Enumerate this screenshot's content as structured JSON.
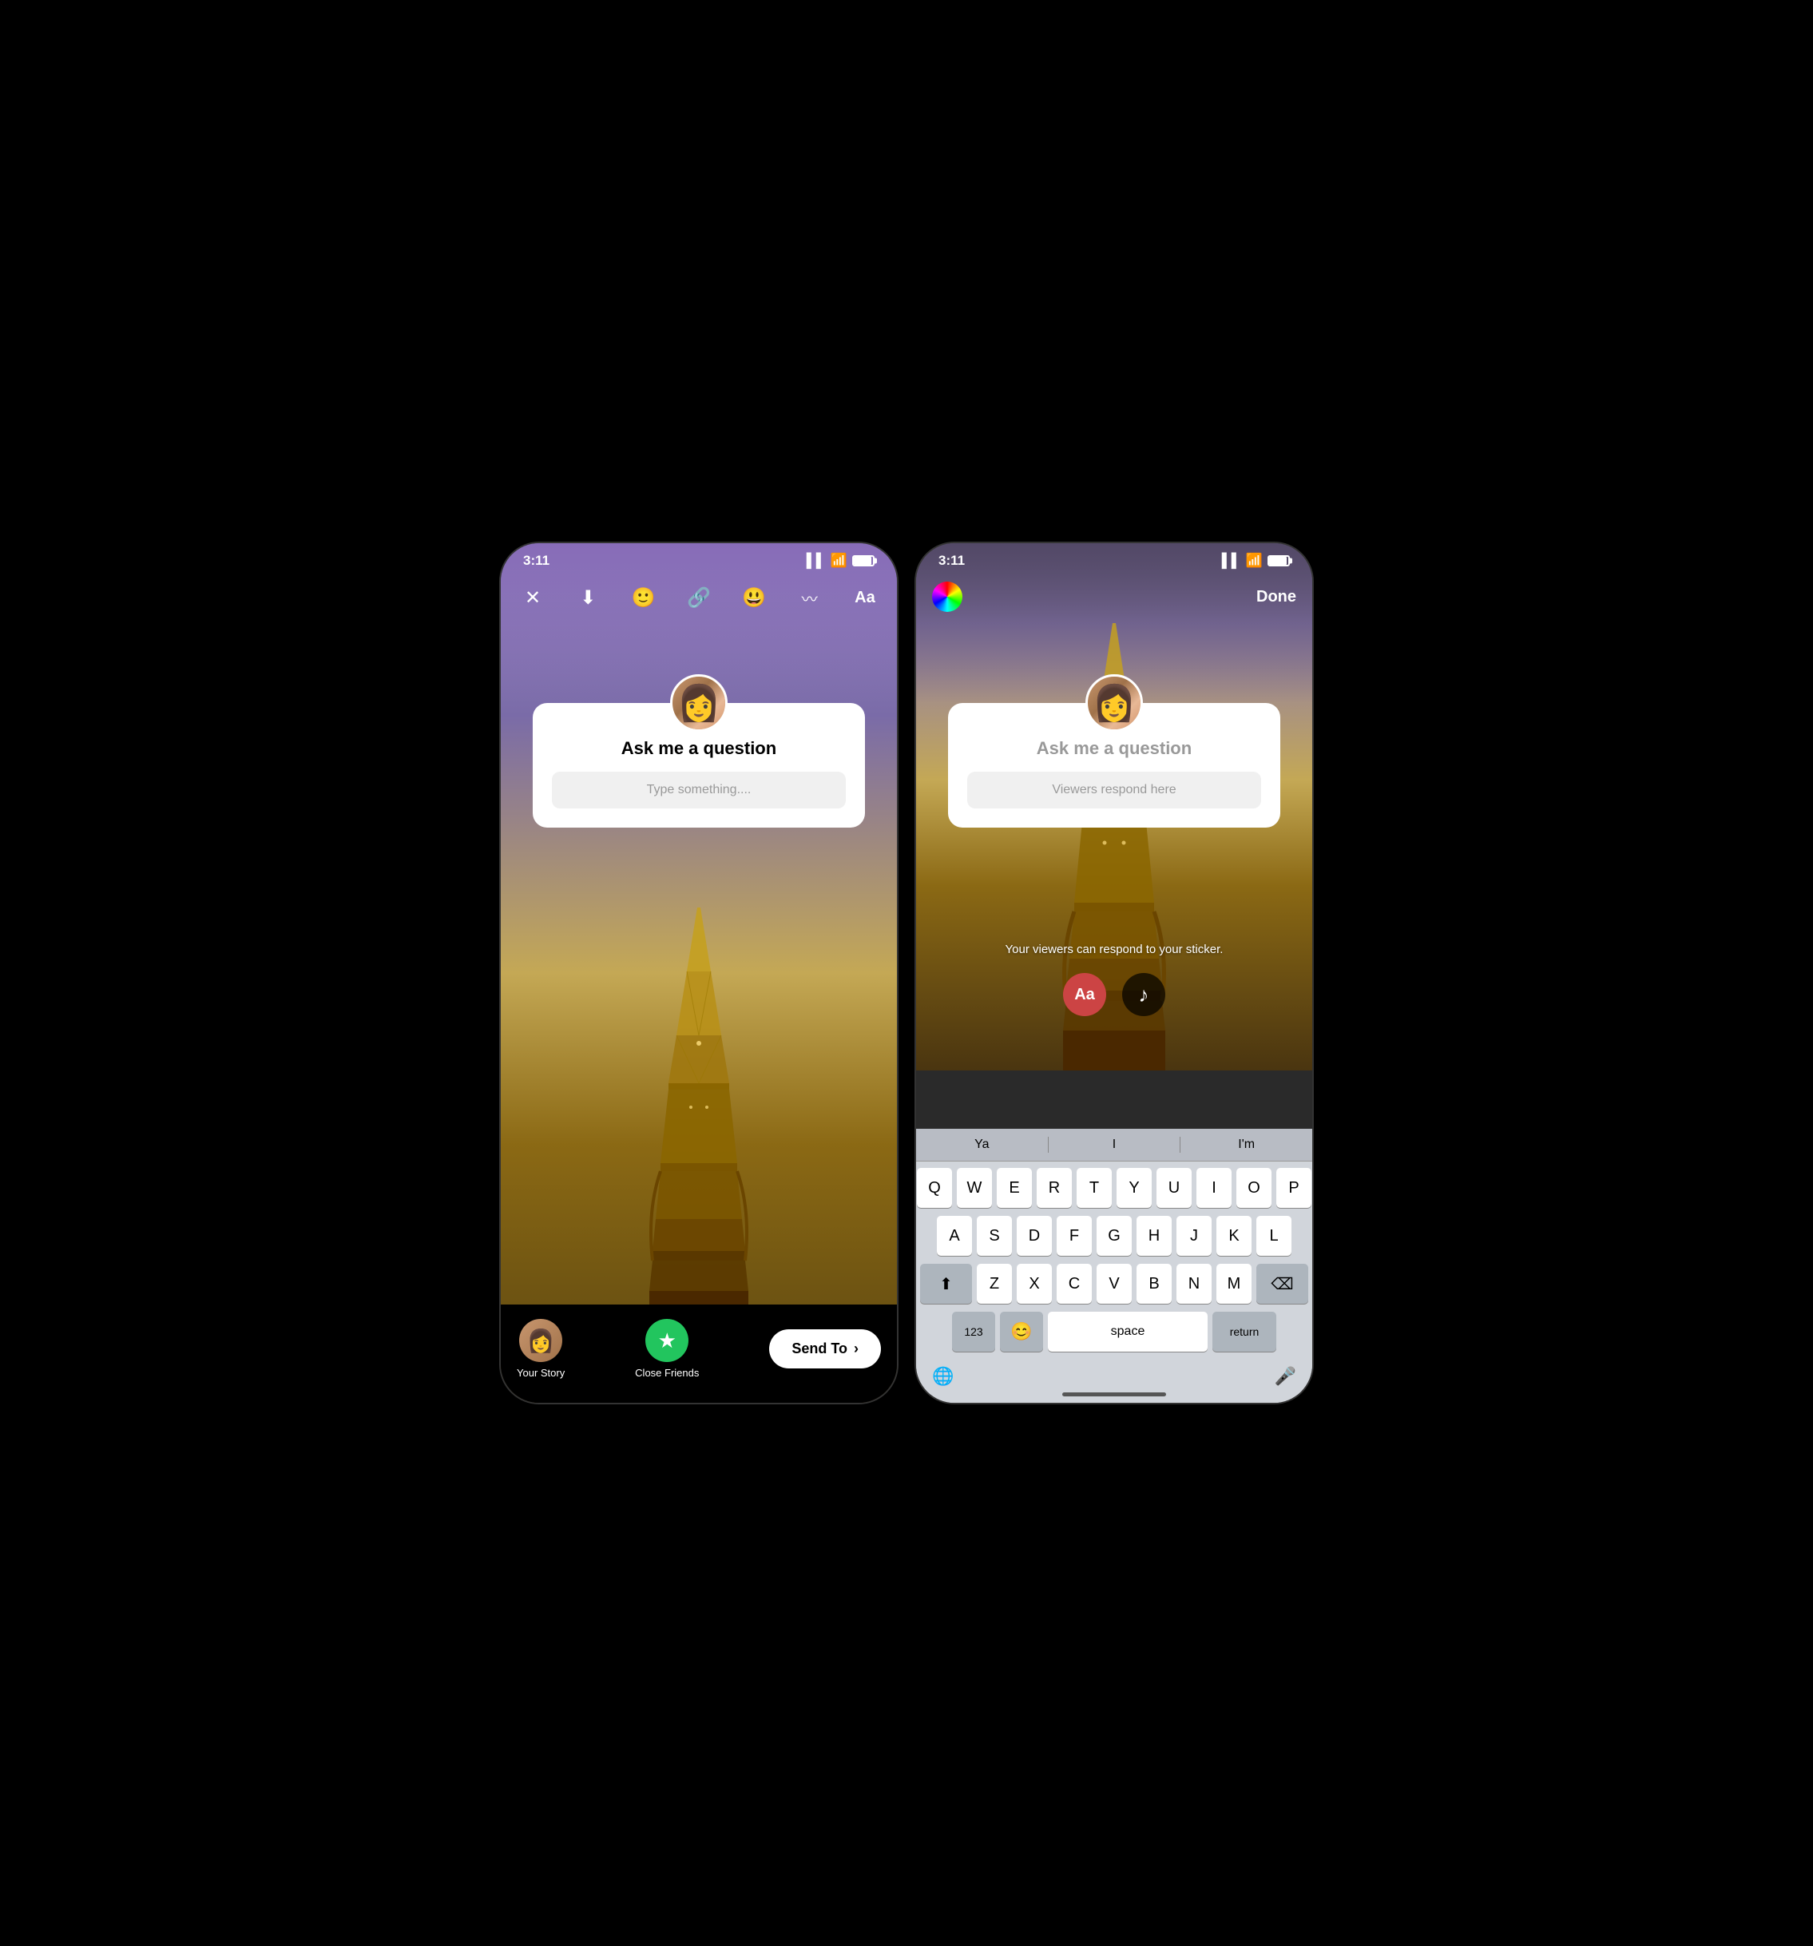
{
  "phones": {
    "left": {
      "status": {
        "time": "3:11",
        "signal": "▌▌",
        "wifi": "wifi",
        "battery": "battery"
      },
      "toolbar": {
        "close": "✕",
        "download": "↓",
        "emoji_add": "😊+",
        "link": "🔗",
        "sticker": "😃",
        "squiggle": "〰",
        "text": "Aa"
      },
      "question_card": {
        "title": "Ask me a question",
        "input_placeholder": "Type something...."
      },
      "bottom_bar": {
        "your_story_label": "Your Story",
        "close_friends_label": "Close Friends",
        "send_to_label": "Send To",
        "send_arrow": "›"
      }
    },
    "right": {
      "status": {
        "time": "3:11"
      },
      "toolbar": {
        "color_wheel": "colorwheel",
        "done": "Done"
      },
      "question_card": {
        "title": "Ask me a question",
        "input_placeholder": "Viewers respond here"
      },
      "viewers_text": "Your viewers can respond to your sticker.",
      "text_tool_label": "Aa",
      "music_tool_label": "♪",
      "keyboard": {
        "autocomplete": [
          "Ya",
          "I",
          "I'm"
        ],
        "row1": [
          "Q",
          "W",
          "E",
          "R",
          "T",
          "Y",
          "U",
          "I",
          "O",
          "P"
        ],
        "row2": [
          "A",
          "S",
          "D",
          "F",
          "G",
          "H",
          "J",
          "K",
          "L"
        ],
        "row3": [
          "Z",
          "X",
          "C",
          "V",
          "B",
          "N",
          "M"
        ],
        "special": {
          "shift": "⬆",
          "delete": "⌫",
          "numbers": "123",
          "emoji": "😊",
          "space": "space",
          "return": "return",
          "globe": "🌐",
          "mic": "🎤"
        }
      }
    }
  }
}
